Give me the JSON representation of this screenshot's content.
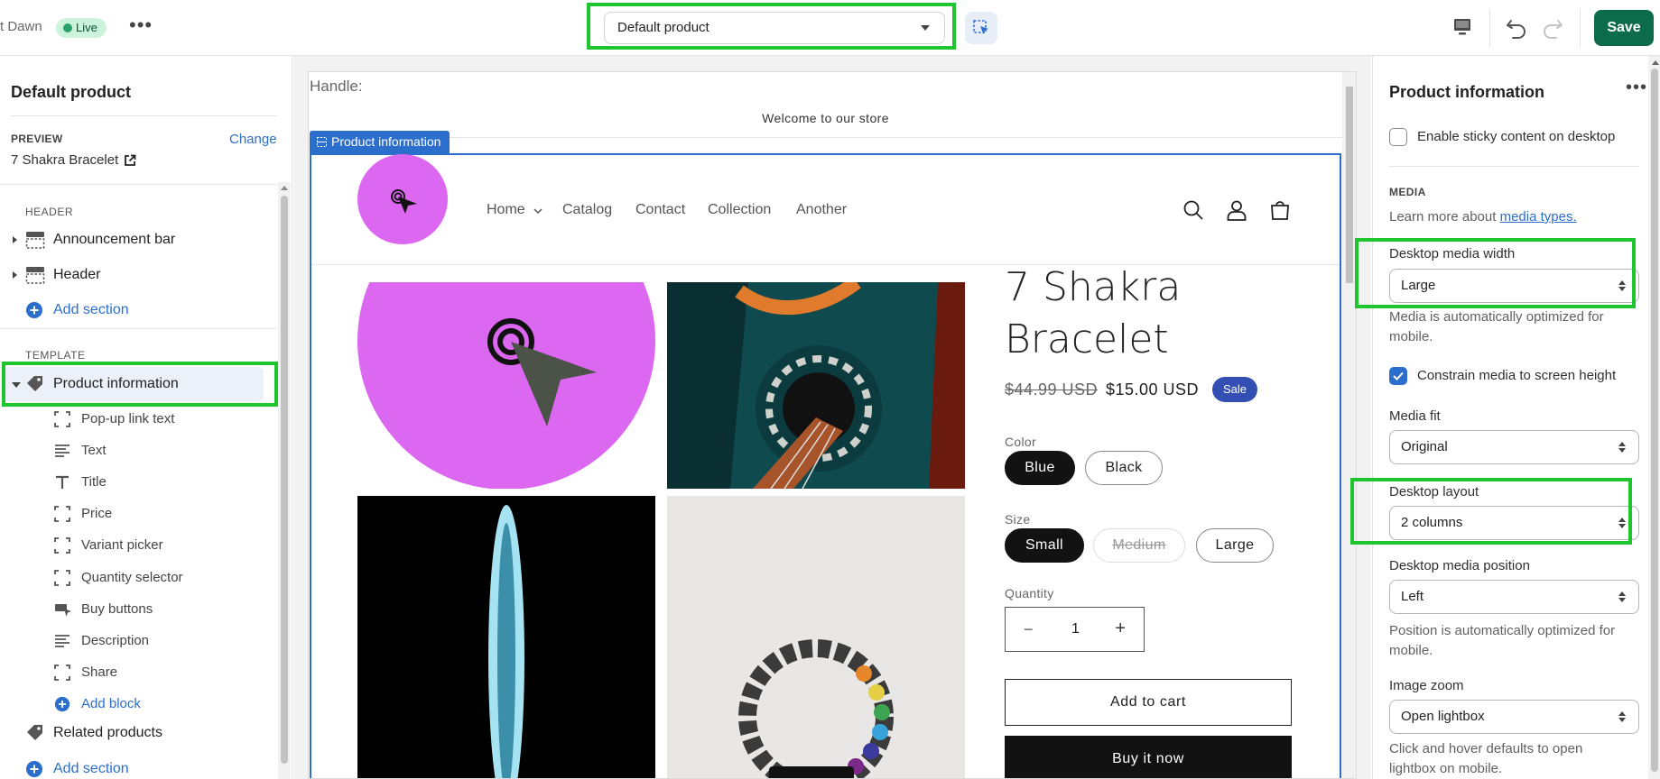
{
  "topbar": {
    "theme_name": "t Dawn",
    "live_label": "Live",
    "template_select": "Default product",
    "save_label": "Save"
  },
  "left": {
    "title": "Default product",
    "preview_label": "PREVIEW",
    "change_label": "Change",
    "preview_product": "7 Shakra Bracelet",
    "header_group": "HEADER",
    "header_items": [
      "Announcement bar",
      "Header"
    ],
    "add_section": "Add section",
    "template_group": "TEMPLATE",
    "selected_section": "Product information",
    "blocks": [
      "Pop-up link text",
      "Text",
      "Title",
      "Price",
      "Variant picker",
      "Quantity selector",
      "Buy buttons",
      "Description",
      "Share"
    ],
    "add_block": "Add block",
    "related_products": "Related products",
    "add_section_bottom": "Add section"
  },
  "preview": {
    "handle": "Handle:",
    "announcement": "Welcome to our store",
    "section_tag": "Product information",
    "nav": [
      "Home",
      "Catalog",
      "Contact",
      "Collection",
      "Another"
    ],
    "product_title": "7 Shakra Bracelet",
    "price_old": "$44.99 USD",
    "price_new": "$15.00 USD",
    "sale_badge": "Sale",
    "color_label": "Color",
    "colors": [
      "Blue",
      "Black"
    ],
    "size_label": "Size",
    "sizes": [
      "Small",
      "Medium",
      "Large"
    ],
    "quantity_label": "Quantity",
    "quantity_value": "1",
    "add_to_cart": "Add to cart",
    "buy_now": "Buy it now"
  },
  "right": {
    "title": "Product information",
    "sticky_label": "Enable sticky content on desktop",
    "media_section": "MEDIA",
    "learn_more_prefix": "Learn more about ",
    "learn_more_link": "media types.",
    "desktop_media_width_label": "Desktop media width",
    "desktop_media_width_value": "Large",
    "media_optimized_help": "Media is automatically optimized for mobile.",
    "constrain_label": "Constrain media to screen height",
    "media_fit_label": "Media fit",
    "media_fit_value": "Original",
    "desktop_layout_label": "Desktop layout",
    "desktop_layout_value": "2 columns",
    "desktop_media_position_label": "Desktop media position",
    "desktop_media_position_value": "Left",
    "position_help": "Position is automatically optimized for mobile.",
    "image_zoom_label": "Image zoom",
    "image_zoom_value": "Open lightbox",
    "zoom_help": "Click and hover defaults to open lightbox on mobile."
  },
  "colors": {
    "save_green": "#0b6b4a",
    "highlight_green": "#1ec52e",
    "accent_blue": "#2c6ecb",
    "sale_blue": "#334fb4",
    "logo_pink": "#dc67f0"
  }
}
